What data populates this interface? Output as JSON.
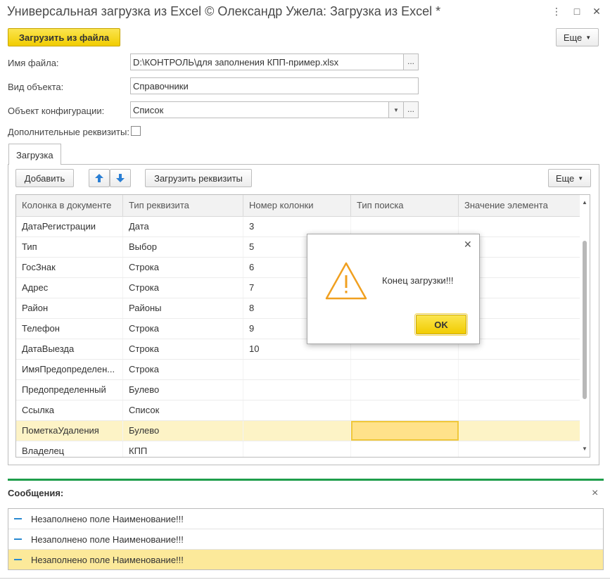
{
  "window": {
    "title": "Универсальная загрузка из Excel © Олександр Ужела: Загрузка из Excel *",
    "menu_icon": "⋮",
    "maximize_icon": "□",
    "close_icon": "✕"
  },
  "toolbar": {
    "load_file_label": "Загрузить из файла",
    "more_label": "Еще"
  },
  "form": {
    "file_name_label": "Имя файла:",
    "file_name_value": "D:\\КОНТРОЛЬ\\для заполнения КПП-пример.xlsx",
    "object_type_label": "Вид объекта:",
    "object_type_value": "Справочники",
    "config_object_label": "Объект конфигурации:",
    "config_object_value": "Список",
    "extra_attrs_label": "Дополнительные реквизиты:",
    "extra_attrs_checked": false,
    "ellipsis": "..."
  },
  "tab": {
    "label": "Загрузка"
  },
  "table_toolbar": {
    "add_label": "Добавить",
    "load_attrs_label": "Загрузить реквизиты",
    "more_label": "Еще"
  },
  "table": {
    "columns": [
      "Колонка в документе",
      "Тип реквизита",
      "Номер колонки",
      "Тип поиска",
      "Значение элемента"
    ],
    "rows": [
      [
        "ДатаРегистрации",
        "Дата",
        "3",
        "",
        ""
      ],
      [
        "Тип",
        "Выбор",
        "5",
        "",
        ""
      ],
      [
        "ГосЗнак",
        "Строка",
        "6",
        "",
        ""
      ],
      [
        "Адрес",
        "Строка",
        "7",
        "",
        ""
      ],
      [
        "Район",
        "Районы",
        "8",
        "",
        ""
      ],
      [
        "Телефон",
        "Строка",
        "9",
        "",
        ""
      ],
      [
        "ДатаВыезда",
        "Строка",
        "10",
        "",
        ""
      ],
      [
        "ИмяПредопределен...",
        "Строка",
        "",
        "",
        ""
      ],
      [
        "Предопределенный",
        "Булево",
        "",
        "",
        ""
      ],
      [
        "Ссылка",
        "Список",
        "",
        "",
        ""
      ],
      [
        "ПометкаУдаления",
        "Булево",
        "",
        "",
        ""
      ],
      [
        "Владелец",
        "КПП",
        "",
        "",
        ""
      ]
    ],
    "selected_row": 10
  },
  "dialog": {
    "message": "Конец загрузки!!!",
    "ok_label": "OK",
    "close_icon": "✕"
  },
  "messages": {
    "title": "Сообщения:",
    "close_icon": "×",
    "items": [
      "Незаполнено поле Наименование!!!",
      "Незаполнено поле Наименование!!!",
      "Незаполнено поле Наименование!!!"
    ],
    "selected_index": 2
  },
  "colors": {
    "accent_yellow": "#f5d30f",
    "message_separator": "#1f9e4b",
    "warning_orange": "#f0a020",
    "selection": "#fdf3c6"
  }
}
